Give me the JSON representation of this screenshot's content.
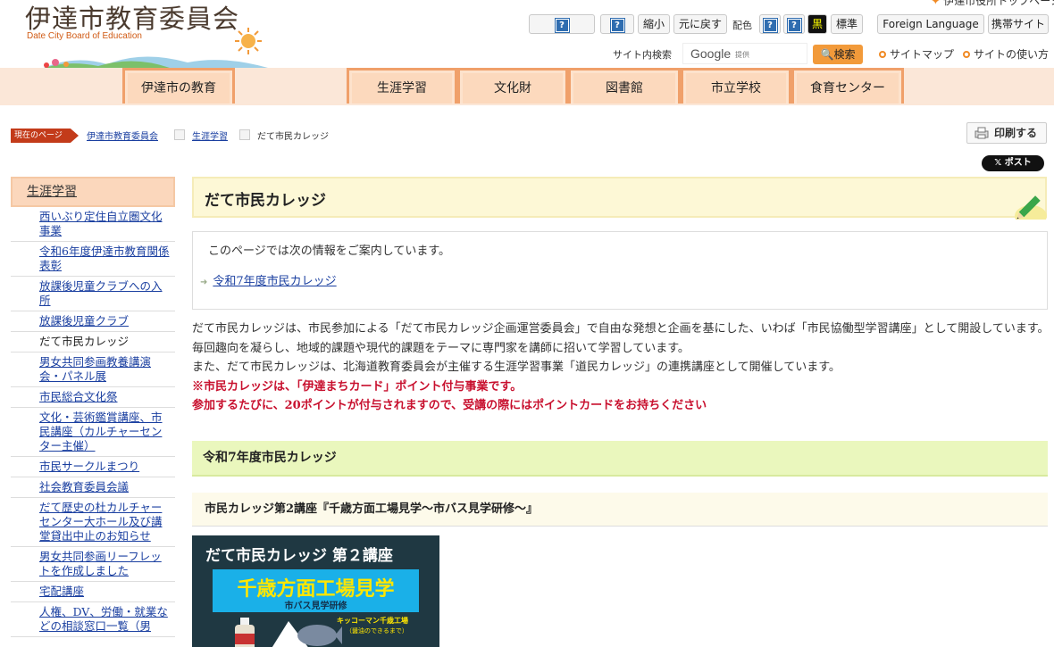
{
  "header": {
    "title": "伊達市教育委員会",
    "subtitle": "Date City Board of Education",
    "top_link": "伊達市役所トップページ"
  },
  "toolbar": {
    "shrink": "縮小",
    "reset": "元に戻す",
    "color_label": "配色",
    "black": "黒",
    "standard": "標準",
    "foreign": "Foreign Language",
    "mobile": "携帯サイト",
    "help_glyph": "?"
  },
  "search": {
    "label": "サイト内検索",
    "google": "Google",
    "provided": "提供",
    "button": "検索"
  },
  "header_links": [
    "サイトマップ",
    "サイトの使い方"
  ],
  "nav": [
    "伊達市の教育",
    "生涯学習",
    "文化財",
    "図書館",
    "市立学校",
    "食育センター"
  ],
  "breadcrumb": {
    "here": "現在のページ",
    "items": [
      "伊達市教育委員会",
      "生涯学習",
      "だて市民カレッジ"
    ]
  },
  "actions": {
    "print": "印刷する",
    "post": "𝕏 ポスト"
  },
  "sidebar": {
    "heading": "生涯学習",
    "items": [
      "西いぶり定住自立圏文化事業",
      "令和6年度伊達市教育関係表彰",
      "放課後児童クラブへの入所",
      "放課後児童クラブ",
      "だて市民カレッジ",
      "男女共同参画教養講演会・パネル展",
      "市民総合文化祭",
      "文化・芸術鑑賞講座、市民講座（カルチャーセンター主催）",
      "市民サークルまつり",
      "社会教育委員会議",
      "だて歴史の杜カルチャーセンター大ホール及び講堂貸出中止のお知らせ",
      "男女共同参画リーフレットを作成しました",
      "宅配講座",
      "人権、DV、労働・就業などの相談窓口一覧（男"
    ],
    "current_index": 4
  },
  "main": {
    "title": "だて市民カレッジ",
    "toc_intro": "このページでは次の情報をご案内しています。",
    "toc_item": "令和7年度市民カレッジ",
    "paragraphs": [
      "だて市民カレッジは、市民参加による「だて市民カレッジ企画運営委員会」で自由な発想と企画を基にした、いわば「市民協働型学習講座」として開設しています。",
      "毎回趣向を凝らし、地域的課題や現代的課題をテーマに専門家を講師に招いて学習しています。",
      "また、だて市民カレッジは、北海道教育委員会が主催する生涯学習事業「道民カレッジ」の連携講座として開催しています。"
    ],
    "notes": [
      "※市民カレッジは、「伊達まちカード」ポイント付与事業です。",
      "参加するたびに、20ポイントが付与されますので、受講の際にはポイントカードをお持ちください"
    ],
    "h2": "令和7年度市民カレッジ",
    "h3": "市民カレッジ第2講座『千歳方面工場見学～市バス見学研修～』"
  },
  "poster": {
    "title": "だて市民カレッジ 第２講座",
    "main": "千歳方面工場見学",
    "sub": "市バス見学研修",
    "note1": "キッコーマン千歳工場",
    "note2": "（醤油のできるまで）"
  },
  "colors": {
    "accent": "#f0a06a",
    "nav_bg": "#fcd9bd",
    "link": "#1a3fa0",
    "alert": "#c8102e",
    "section_green": "#eaf7bd"
  }
}
